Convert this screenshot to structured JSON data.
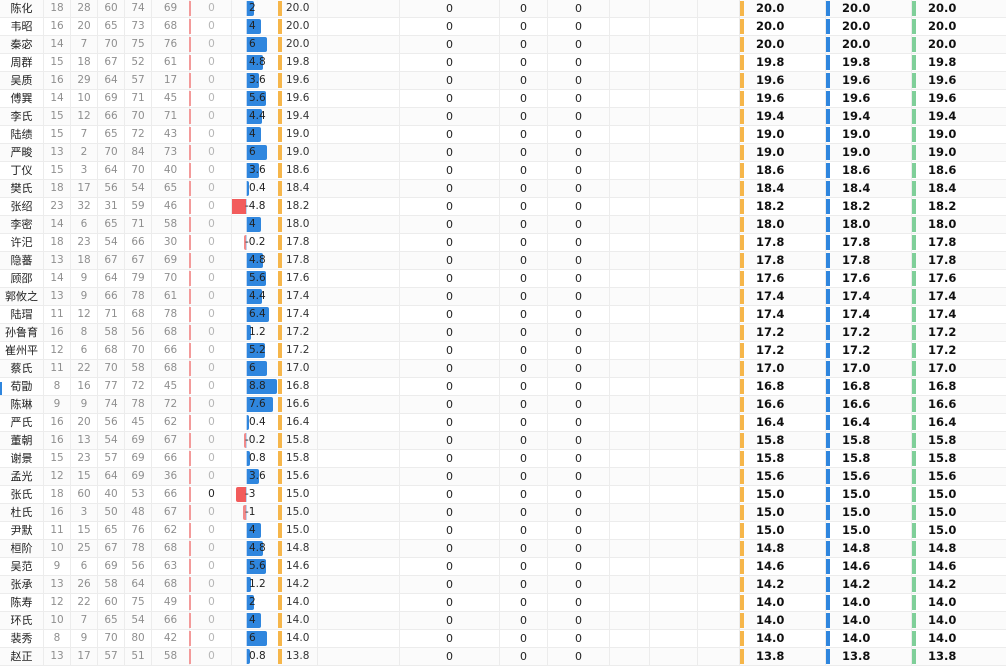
{
  "colors": {
    "orange": "#f6b64a",
    "blue": "#2f86de",
    "green": "#7fcf99",
    "red": "#f25c5c"
  },
  "rows": [
    {
      "name": "陈化",
      "stats": [
        "18",
        "28",
        "60",
        "74",
        "69"
      ],
      "zero": "0",
      "change": "2",
      "value": "20.0",
      "z": [
        "0",
        "0",
        "0"
      ],
      "totals": [
        "20.0",
        "20.0",
        "20.0"
      ]
    },
    {
      "name": "韦昭",
      "stats": [
        "16",
        "20",
        "65",
        "73",
        "68"
      ],
      "zero": "0",
      "change": "4",
      "value": "20.0",
      "z": [
        "0",
        "0",
        "0"
      ],
      "totals": [
        "20.0",
        "20.0",
        "20.0"
      ]
    },
    {
      "name": "秦宓",
      "stats": [
        "14",
        "7",
        "70",
        "75",
        "76"
      ],
      "zero": "0",
      "change": "6",
      "value": "20.0",
      "z": [
        "0",
        "0",
        "0"
      ],
      "totals": [
        "20.0",
        "20.0",
        "20.0"
      ]
    },
    {
      "name": "周群",
      "stats": [
        "15",
        "18",
        "67",
        "52",
        "61"
      ],
      "zero": "0",
      "change": "4.8",
      "value": "19.8",
      "z": [
        "0",
        "0",
        "0"
      ],
      "totals": [
        "19.8",
        "19.8",
        "19.8"
      ]
    },
    {
      "name": "吴质",
      "stats": [
        "16",
        "29",
        "64",
        "57",
        "17"
      ],
      "zero": "0",
      "change": "3.6",
      "value": "19.6",
      "z": [
        "0",
        "0",
        "0"
      ],
      "totals": [
        "19.6",
        "19.6",
        "19.6"
      ]
    },
    {
      "name": "傅巽",
      "stats": [
        "14",
        "10",
        "69",
        "71",
        "45"
      ],
      "zero": "0",
      "change": "5.6",
      "value": "19.6",
      "z": [
        "0",
        "0",
        "0"
      ],
      "totals": [
        "19.6",
        "19.6",
        "19.6"
      ]
    },
    {
      "name": "李氏",
      "stats": [
        "15",
        "12",
        "66",
        "70",
        "71"
      ],
      "zero": "0",
      "change": "4.4",
      "value": "19.4",
      "z": [
        "0",
        "0",
        "0"
      ],
      "totals": [
        "19.4",
        "19.4",
        "19.4"
      ]
    },
    {
      "name": "陆绩",
      "stats": [
        "15",
        "7",
        "65",
        "72",
        "43"
      ],
      "zero": "0",
      "change": "4",
      "value": "19.0",
      "z": [
        "0",
        "0",
        "0"
      ],
      "totals": [
        "19.0",
        "19.0",
        "19.0"
      ]
    },
    {
      "name": "严畯",
      "stats": [
        "13",
        "2",
        "70",
        "84",
        "73"
      ],
      "zero": "0",
      "change": "6",
      "value": "19.0",
      "z": [
        "0",
        "0",
        "0"
      ],
      "totals": [
        "19.0",
        "19.0",
        "19.0"
      ]
    },
    {
      "name": "丁仪",
      "stats": [
        "15",
        "3",
        "64",
        "70",
        "40"
      ],
      "zero": "0",
      "change": "3.6",
      "value": "18.6",
      "z": [
        "0",
        "0",
        "0"
      ],
      "totals": [
        "18.6",
        "18.6",
        "18.6"
      ]
    },
    {
      "name": "樊氏",
      "stats": [
        "18",
        "17",
        "56",
        "54",
        "65"
      ],
      "zero": "0",
      "change": "0.4",
      "value": "18.4",
      "z": [
        "0",
        "0",
        "0"
      ],
      "totals": [
        "18.4",
        "18.4",
        "18.4"
      ]
    },
    {
      "name": "张绍",
      "stats": [
        "23",
        "32",
        "31",
        "59",
        "46"
      ],
      "zero": "0",
      "change": "-4.8",
      "value": "18.2",
      "z": [
        "0",
        "0",
        "0"
      ],
      "totals": [
        "18.2",
        "18.2",
        "18.2"
      ]
    },
    {
      "name": "李密",
      "stats": [
        "14",
        "6",
        "65",
        "71",
        "58"
      ],
      "zero": "0",
      "change": "4",
      "value": "18.0",
      "z": [
        "0",
        "0",
        "0"
      ],
      "totals": [
        "18.0",
        "18.0",
        "18.0"
      ]
    },
    {
      "name": "许汜",
      "stats": [
        "18",
        "23",
        "54",
        "66",
        "30"
      ],
      "zero": "0",
      "change": "-0.2",
      "value": "17.8",
      "z": [
        "0",
        "0",
        "0"
      ],
      "totals": [
        "17.8",
        "17.8",
        "17.8"
      ]
    },
    {
      "name": "隐蕃",
      "stats": [
        "13",
        "18",
        "67",
        "67",
        "69"
      ],
      "zero": "0",
      "change": "4.8",
      "value": "17.8",
      "z": [
        "0",
        "0",
        "0"
      ],
      "totals": [
        "17.8",
        "17.8",
        "17.8"
      ]
    },
    {
      "name": "顾邵",
      "stats": [
        "14",
        "9",
        "64",
        "79",
        "70"
      ],
      "zero": "0",
      "change": "5.6",
      "value": "17.6",
      "z": [
        "0",
        "0",
        "0"
      ],
      "totals": [
        "17.6",
        "17.6",
        "17.6"
      ]
    },
    {
      "name": "郭攸之",
      "stats": [
        "13",
        "9",
        "66",
        "78",
        "61"
      ],
      "zero": "0",
      "change": "4.4",
      "value": "17.4",
      "z": [
        "0",
        "0",
        "0"
      ],
      "totals": [
        "17.4",
        "17.4",
        "17.4"
      ]
    },
    {
      "name": "陆瑁",
      "stats": [
        "11",
        "12",
        "71",
        "68",
        "78"
      ],
      "zero": "0",
      "change": "6.4",
      "value": "17.4",
      "z": [
        "0",
        "0",
        "0"
      ],
      "totals": [
        "17.4",
        "17.4",
        "17.4"
      ]
    },
    {
      "name": "孙鲁育",
      "stats": [
        "16",
        "8",
        "58",
        "56",
        "68"
      ],
      "zero": "0",
      "change": "1.2",
      "value": "17.2",
      "z": [
        "0",
        "0",
        "0"
      ],
      "totals": [
        "17.2",
        "17.2",
        "17.2"
      ]
    },
    {
      "name": "崔州平",
      "stats": [
        "12",
        "6",
        "68",
        "70",
        "66"
      ],
      "zero": "0",
      "change": "5.2",
      "value": "17.2",
      "z": [
        "0",
        "0",
        "0"
      ],
      "totals": [
        "17.2",
        "17.2",
        "17.2"
      ]
    },
    {
      "name": "蔡氏",
      "stats": [
        "11",
        "22",
        "70",
        "58",
        "68"
      ],
      "zero": "0",
      "change": "6",
      "value": "17.0",
      "z": [
        "0",
        "0",
        "0"
      ],
      "totals": [
        "17.0",
        "17.0",
        "17.0"
      ]
    },
    {
      "name": "荀勖",
      "stats": [
        "8",
        "16",
        "77",
        "72",
        "45"
      ],
      "zero": "0",
      "change": "8.8",
      "value": "16.8",
      "z": [
        "0",
        "0",
        "0"
      ],
      "totals": [
        "16.8",
        "16.8",
        "16.8"
      ]
    },
    {
      "name": "陈琳",
      "stats": [
        "9",
        "9",
        "74",
        "78",
        "72"
      ],
      "zero": "0",
      "change": "7.6",
      "value": "16.6",
      "z": [
        "0",
        "0",
        "0"
      ],
      "totals": [
        "16.6",
        "16.6",
        "16.6"
      ]
    },
    {
      "name": "严氏",
      "stats": [
        "16",
        "20",
        "56",
        "45",
        "62"
      ],
      "zero": "0",
      "change": "0.4",
      "value": "16.4",
      "z": [
        "0",
        "0",
        "0"
      ],
      "totals": [
        "16.4",
        "16.4",
        "16.4"
      ]
    },
    {
      "name": "董朝",
      "stats": [
        "16",
        "13",
        "54",
        "69",
        "67"
      ],
      "zero": "0",
      "change": "-0.2",
      "value": "15.8",
      "z": [
        "0",
        "0",
        "0"
      ],
      "totals": [
        "15.8",
        "15.8",
        "15.8"
      ]
    },
    {
      "name": "谢景",
      "stats": [
        "15",
        "23",
        "57",
        "69",
        "66"
      ],
      "zero": "0",
      "change": "0.8",
      "value": "15.8",
      "z": [
        "0",
        "0",
        "0"
      ],
      "totals": [
        "15.8",
        "15.8",
        "15.8"
      ]
    },
    {
      "name": "孟光",
      "stats": [
        "12",
        "15",
        "64",
        "69",
        "36"
      ],
      "zero": "0",
      "change": "3.6",
      "value": "15.6",
      "z": [
        "0",
        "0",
        "0"
      ],
      "totals": [
        "15.6",
        "15.6",
        "15.6"
      ]
    },
    {
      "name": "张氏",
      "stats": [
        "18",
        "60",
        "40",
        "53",
        "66"
      ],
      "zero": "0",
      "zero_dark": true,
      "change": "-3",
      "value": "15.0",
      "z": [
        "0",
        "0",
        "0"
      ],
      "totals": [
        "15.0",
        "15.0",
        "15.0"
      ]
    },
    {
      "name": "杜氏",
      "stats": [
        "16",
        "3",
        "50",
        "48",
        "67"
      ],
      "zero": "0",
      "change": "-1",
      "value": "15.0",
      "z": [
        "0",
        "0",
        "0"
      ],
      "totals": [
        "15.0",
        "15.0",
        "15.0"
      ]
    },
    {
      "name": "尹默",
      "stats": [
        "11",
        "15",
        "65",
        "76",
        "62"
      ],
      "zero": "0",
      "change": "4",
      "value": "15.0",
      "z": [
        "0",
        "0",
        "0"
      ],
      "totals": [
        "15.0",
        "15.0",
        "15.0"
      ]
    },
    {
      "name": "桓阶",
      "stats": [
        "10",
        "25",
        "67",
        "78",
        "68"
      ],
      "zero": "0",
      "change": "4.8",
      "value": "14.8",
      "z": [
        "0",
        "0",
        "0"
      ],
      "totals": [
        "14.8",
        "14.8",
        "14.8"
      ]
    },
    {
      "name": "吴范",
      "stats": [
        "9",
        "6",
        "69",
        "56",
        "63"
      ],
      "zero": "0",
      "change": "5.6",
      "value": "14.6",
      "z": [
        "0",
        "0",
        "0"
      ],
      "totals": [
        "14.6",
        "14.6",
        "14.6"
      ]
    },
    {
      "name": "张承",
      "stats": [
        "13",
        "26",
        "58",
        "64",
        "68"
      ],
      "zero": "0",
      "change": "1.2",
      "value": "14.2",
      "z": [
        "0",
        "0",
        "0"
      ],
      "totals": [
        "14.2",
        "14.2",
        "14.2"
      ]
    },
    {
      "name": "陈寿",
      "stats": [
        "12",
        "22",
        "60",
        "75",
        "49"
      ],
      "zero": "0",
      "change": "2",
      "value": "14.0",
      "z": [
        "0",
        "0",
        "0"
      ],
      "totals": [
        "14.0",
        "14.0",
        "14.0"
      ]
    },
    {
      "name": "环氏",
      "stats": [
        "10",
        "7",
        "65",
        "54",
        "66"
      ],
      "zero": "0",
      "change": "4",
      "value": "14.0",
      "z": [
        "0",
        "0",
        "0"
      ],
      "totals": [
        "14.0",
        "14.0",
        "14.0"
      ]
    },
    {
      "name": "裴秀",
      "stats": [
        "8",
        "9",
        "70",
        "80",
        "42"
      ],
      "zero": "0",
      "change": "6",
      "value": "14.0",
      "z": [
        "0",
        "0",
        "0"
      ],
      "totals": [
        "14.0",
        "14.0",
        "14.0"
      ]
    },
    {
      "name": "赵正",
      "stats": [
        "13",
        "17",
        "57",
        "51",
        "58"
      ],
      "zero": "0",
      "change": "0.8",
      "value": "13.8",
      "z": [
        "0",
        "0",
        "0"
      ],
      "totals": [
        "13.8",
        "13.8",
        "13.8"
      ]
    }
  ]
}
